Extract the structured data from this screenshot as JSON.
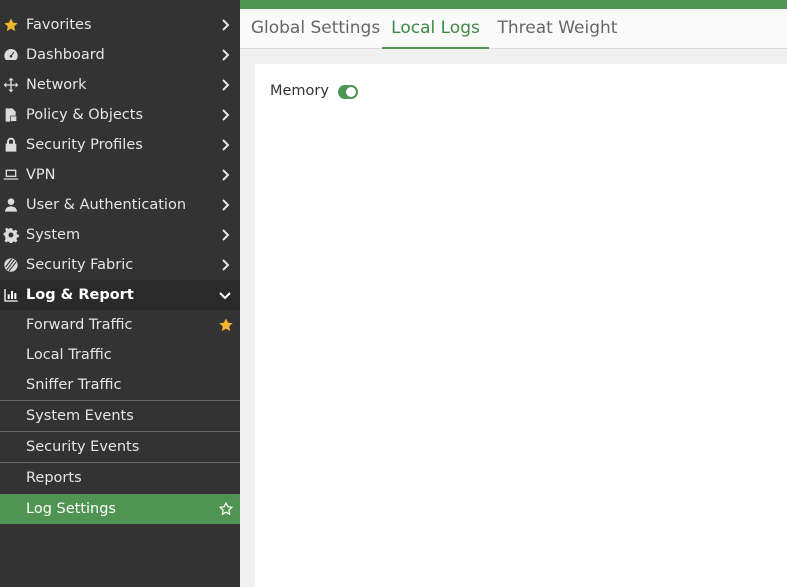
{
  "sidebar": {
    "items": [
      {
        "label": "Favorites",
        "icon": "star-icon"
      },
      {
        "label": "Dashboard",
        "icon": "dashboard-icon"
      },
      {
        "label": "Network",
        "icon": "network-icon"
      },
      {
        "label": "Policy & Objects",
        "icon": "policy-icon"
      },
      {
        "label": "Security Profiles",
        "icon": "lock-icon"
      },
      {
        "label": "VPN",
        "icon": "laptop-icon"
      },
      {
        "label": "User & Authentication",
        "icon": "user-icon"
      },
      {
        "label": "System",
        "icon": "gear-icon"
      },
      {
        "label": "Security Fabric",
        "icon": "fabric-icon"
      },
      {
        "label": "Log & Report",
        "icon": "bar-chart-icon"
      }
    ],
    "subitems": [
      {
        "label": "Forward Traffic",
        "favorite": true
      },
      {
        "label": "Local Traffic"
      },
      {
        "label": "Sniffer Traffic"
      },
      {
        "label": "System Events"
      },
      {
        "label": "Security Events"
      },
      {
        "label": "Reports"
      },
      {
        "label": "Log Settings",
        "selected": true
      }
    ]
  },
  "tabs": [
    {
      "label": "Global Settings"
    },
    {
      "label": "Local Logs",
      "active": true
    },
    {
      "label": "Threat Weight"
    }
  ],
  "settings": {
    "memory_label": "Memory",
    "memory_enabled": true
  },
  "colors": {
    "accent": "#4f9452",
    "sidebar_bg": "#333333",
    "favorite_star": "#f2b632"
  }
}
